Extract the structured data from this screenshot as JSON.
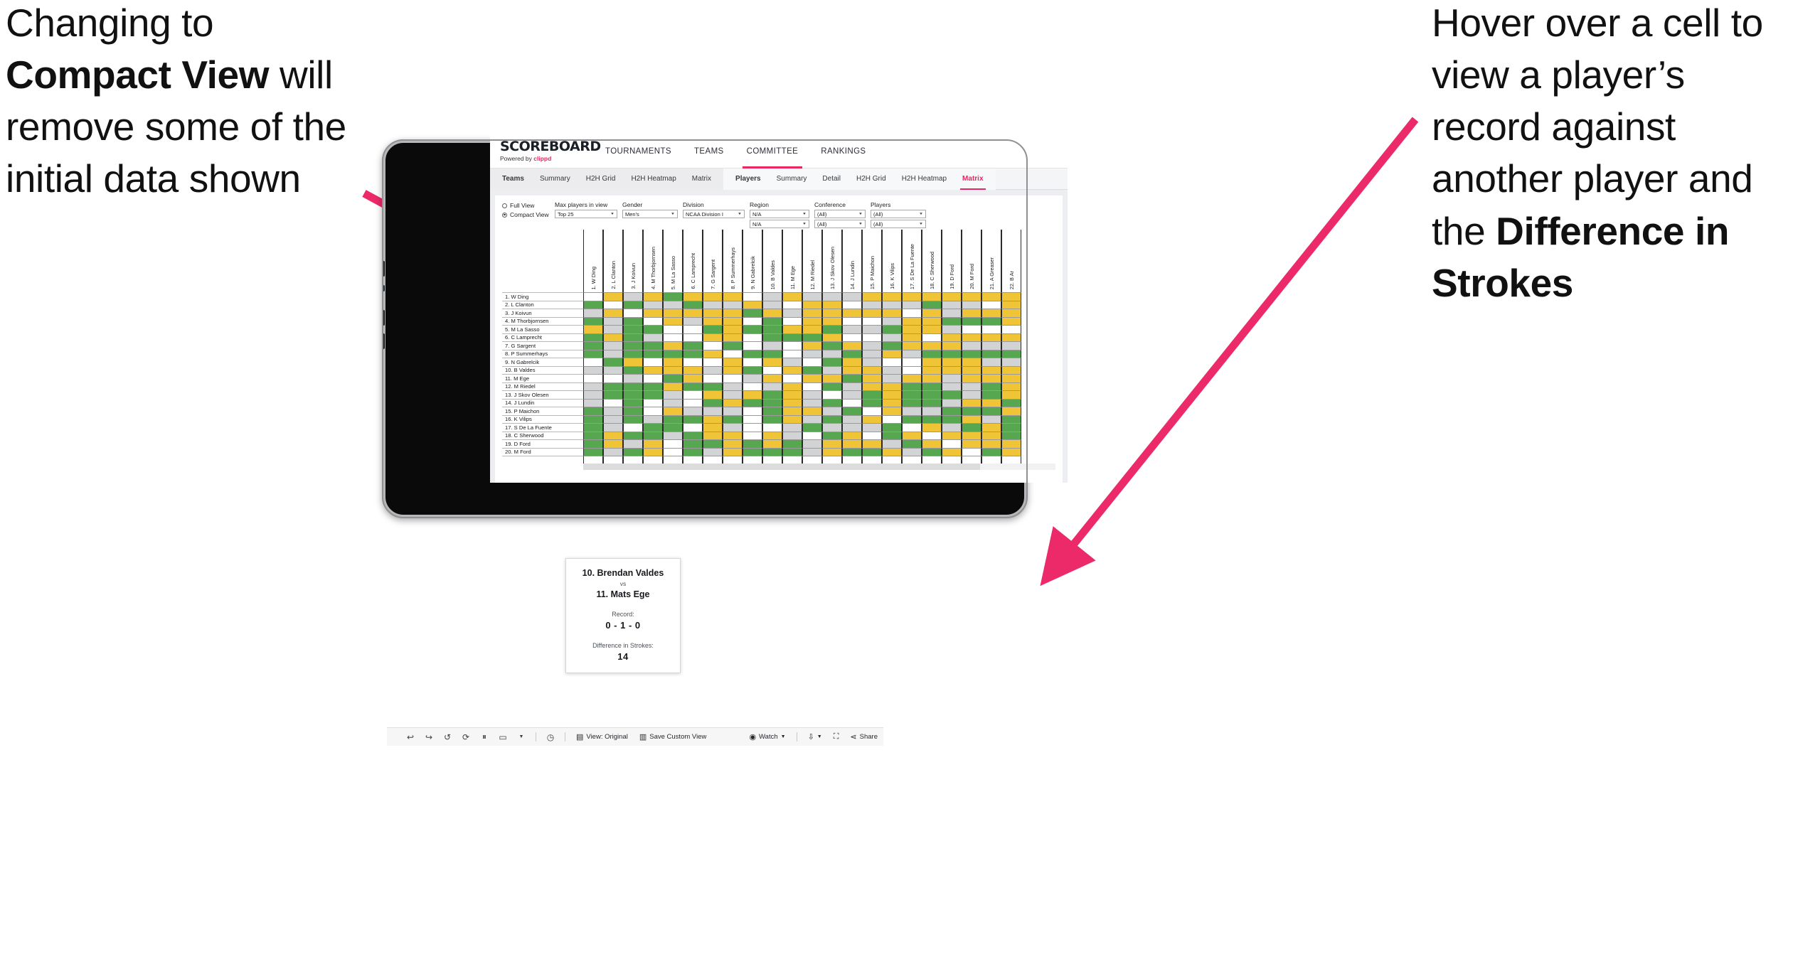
{
  "annotations": {
    "left": {
      "line1": "Changing to",
      "bold1": "Compact View",
      "line2": " will remove some of the initial data shown"
    },
    "right": {
      "line1": "Hover over a cell to view a player’s record against another player and the ",
      "bold1": "Difference in Strokes"
    },
    "arrow_color": "#ec2a6a"
  },
  "app": {
    "logo": {
      "word": "SCOREBOARD",
      "powered_prefix": "Powered by ",
      "brand": "clippd"
    },
    "main_nav": [
      {
        "label": "TOURNAMENTS",
        "active": false
      },
      {
        "label": "TEAMS",
        "active": false
      },
      {
        "label": "COMMITTEE",
        "active": true
      },
      {
        "label": "RANKINGS",
        "active": false
      }
    ],
    "sub_nav_teams": [
      {
        "label": "Teams",
        "bold": true,
        "active": false
      },
      {
        "label": "Summary",
        "bold": false,
        "active": false
      },
      {
        "label": "H2H Grid",
        "bold": false,
        "active": false
      },
      {
        "label": "H2H Heatmap",
        "bold": false,
        "active": false
      },
      {
        "label": "Matrix",
        "bold": false,
        "active": false
      }
    ],
    "sub_nav_players": [
      {
        "label": "Players",
        "bold": true,
        "active": false
      },
      {
        "label": "Summary",
        "bold": false,
        "active": false
      },
      {
        "label": "Detail",
        "bold": false,
        "active": false
      },
      {
        "label": "H2H Grid",
        "bold": false,
        "active": false
      },
      {
        "label": "H2H Heatmap",
        "bold": false,
        "active": false
      },
      {
        "label": "Matrix",
        "bold": false,
        "active": true
      }
    ],
    "accent_color": "#e8285f"
  },
  "filters": {
    "view_mode": {
      "full_label": "Full View",
      "compact_label": "Compact View",
      "selected": "Compact View"
    },
    "max_players": {
      "label": "Max players in view",
      "value": "Top 25"
    },
    "gender": {
      "label": "Gender",
      "value": "Men's"
    },
    "division": {
      "label": "Division",
      "value": "NCAA Division I"
    },
    "region": {
      "label": "Region",
      "value1": "N/A",
      "value2": "N/A"
    },
    "conference": {
      "label": "Conference",
      "value1": "(All)",
      "value2": "(All)"
    },
    "players": {
      "label": "Players",
      "value1": "(All)",
      "value2": "(All)"
    }
  },
  "matrix": {
    "row_labels": [
      "1. W Ding",
      "2. L Clanton",
      "3. J Koivun",
      "4. M Thorbjornsen",
      "5. M La Sasso",
      "6. C Lamprecht",
      "7. G Sargent",
      "8. P Summerhays",
      "9. N Gabrelcik",
      "10. B Valdes",
      "11. M Ege",
      "12. M Riedel",
      "13. J Skov Olesen",
      "14. J Lundin",
      "15. P Maichon",
      "16. K Vilips",
      "17. S De La Fuente",
      "18. C Sherwood",
      "19. D Ford",
      "20. M Ford"
    ],
    "column_labels": [
      "1. W Ding",
      "2. L Clanton",
      "3. J Koivun",
      "4. M Thorbjornsen",
      "5. M La Sasso",
      "6. C Lamprecht",
      "7. G Sargent",
      "8. P Summerhays",
      "9. N Gabrelcik",
      "10. B Valdes",
      "11. M Ege",
      "12. M Riedel",
      "13. J Skov Olesen",
      "14. J Lundin",
      "15. P Maichon",
      "16. K Vilips",
      "17. S De La Fuente",
      "18. C Sherwood",
      "19. D Ford",
      "20. M Ford",
      "21. A Greaser",
      "22. B Ar"
    ],
    "legend": {
      "win": "#57a750",
      "loss": "#efc437",
      "tie": "#d2d3d5",
      "none": "#ffffff"
    },
    "cells": [
      [
        "w",
        "y",
        "a",
        "y",
        "g",
        "y",
        "y",
        "y",
        "w",
        "a",
        "y",
        "a",
        "a",
        "a",
        "y",
        "y",
        "y",
        "y",
        "y",
        "y",
        "y",
        "y"
      ],
      [
        "g",
        "w",
        "g",
        "a",
        "a",
        "g",
        "a",
        "a",
        "y",
        "a",
        "w",
        "y",
        "y",
        "w",
        "a",
        "a",
        "a",
        "g",
        "a",
        "a",
        "w",
        "y"
      ],
      [
        "a",
        "y",
        "w",
        "y",
        "y",
        "y",
        "y",
        "y",
        "g",
        "y",
        "a",
        "y",
        "y",
        "y",
        "y",
        "y",
        "w",
        "y",
        "a",
        "y",
        "y",
        "y"
      ],
      [
        "g",
        "a",
        "g",
        "w",
        "y",
        "a",
        "y",
        "y",
        "w",
        "g",
        "w",
        "y",
        "y",
        "w",
        "w",
        "a",
        "y",
        "y",
        "g",
        "g",
        "g",
        "y"
      ],
      [
        "y",
        "a",
        "g",
        "g",
        "w",
        "w",
        "g",
        "y",
        "g",
        "g",
        "y",
        "y",
        "g",
        "a",
        "a",
        "g",
        "y",
        "y",
        "a",
        "w",
        "w",
        "w"
      ],
      [
        "g",
        "y",
        "g",
        "a",
        "w",
        "w",
        "y",
        "y",
        "w",
        "g",
        "g",
        "g",
        "y",
        "w",
        "w",
        "a",
        "y",
        "w",
        "y",
        "y",
        "y",
        "y"
      ],
      [
        "g",
        "a",
        "g",
        "g",
        "y",
        "g",
        "w",
        "g",
        "w",
        "a",
        "w",
        "y",
        "g",
        "y",
        "a",
        "g",
        "y",
        "y",
        "y",
        "a",
        "a",
        "a"
      ],
      [
        "g",
        "a",
        "g",
        "g",
        "g",
        "g",
        "y",
        "w",
        "g",
        "g",
        "w",
        "a",
        "a",
        "g",
        "a",
        "y",
        "a",
        "g",
        "g",
        "g",
        "g",
        "g"
      ],
      [
        "w",
        "g",
        "y",
        "w",
        "y",
        "w",
        "w",
        "y",
        "w",
        "y",
        "a",
        "w",
        "g",
        "y",
        "a",
        "w",
        "w",
        "y",
        "y",
        "y",
        "a",
        "a"
      ],
      [
        "a",
        "a",
        "g",
        "y",
        "y",
        "y",
        "a",
        "y",
        "g",
        "w",
        "y",
        "g",
        "a",
        "y",
        "y",
        "a",
        "w",
        "y",
        "y",
        "y",
        "y",
        "y"
      ],
      [
        "w",
        "w",
        "a",
        "w",
        "g",
        "y",
        "w",
        "w",
        "a",
        "y",
        "w",
        "y",
        "y",
        "g",
        "y",
        "a",
        "y",
        "y",
        "a",
        "y",
        "y",
        "y"
      ],
      [
        "a",
        "g",
        "g",
        "g",
        "y",
        "g",
        "g",
        "a",
        "w",
        "a",
        "y",
        "w",
        "g",
        "a",
        "y",
        "y",
        "g",
        "g",
        "a",
        "a",
        "g",
        "y"
      ],
      [
        "a",
        "g",
        "g",
        "g",
        "a",
        "w",
        "y",
        "a",
        "y",
        "g",
        "y",
        "a",
        "w",
        "a",
        "g",
        "y",
        "g",
        "g",
        "g",
        "a",
        "g",
        "y"
      ],
      [
        "a",
        "w",
        "g",
        "w",
        "a",
        "w",
        "g",
        "y",
        "g",
        "g",
        "y",
        "a",
        "g",
        "w",
        "g",
        "y",
        "g",
        "g",
        "a",
        "y",
        "y",
        "g"
      ],
      [
        "g",
        "a",
        "g",
        "w",
        "y",
        "a",
        "a",
        "a",
        "w",
        "g",
        "y",
        "y",
        "a",
        "g",
        "w",
        "y",
        "a",
        "a",
        "g",
        "g",
        "g",
        "y"
      ],
      [
        "g",
        "a",
        "g",
        "a",
        "g",
        "g",
        "y",
        "g",
        "w",
        "g",
        "y",
        "a",
        "g",
        "a",
        "y",
        "w",
        "g",
        "g",
        "g",
        "y",
        "a",
        "g"
      ],
      [
        "g",
        "a",
        "w",
        "g",
        "g",
        "w",
        "y",
        "a",
        "w",
        "w",
        "a",
        "g",
        "a",
        "a",
        "a",
        "g",
        "w",
        "y",
        "a",
        "g",
        "y",
        "g"
      ],
      [
        "g",
        "y",
        "g",
        "g",
        "a",
        "g",
        "y",
        "y",
        "w",
        "y",
        "a",
        "w",
        "g",
        "y",
        "w",
        "g",
        "y",
        "w",
        "y",
        "y",
        "y",
        "g"
      ],
      [
        "g",
        "y",
        "a",
        "y",
        "w",
        "g",
        "g",
        "y",
        "g",
        "y",
        "g",
        "a",
        "y",
        "y",
        "y",
        "a",
        "g",
        "y",
        "w",
        "y",
        "y",
        "y"
      ],
      [
        "g",
        "a",
        "g",
        "y",
        "w",
        "g",
        "a",
        "y",
        "g",
        "g",
        "g",
        "a",
        "y",
        "g",
        "g",
        "y",
        "a",
        "g",
        "y",
        "w",
        "g",
        "y"
      ]
    ]
  },
  "tooltip": {
    "player_a": "10. Brendan Valdes",
    "vs": "vs",
    "player_b": "11. Mats Ege",
    "record_label": "Record:",
    "record_value": "0 - 1 - 0",
    "diff_label": "Difference in Strokes:",
    "diff_value": "14"
  },
  "toolbar": {
    "icons": [
      "undo-icon",
      "redo-icon",
      "revert-icon",
      "refresh-icon",
      "pause-icon",
      "pill-icon",
      "caret-icon",
      "help-icon"
    ],
    "view_label": "View: Original",
    "save_label": "Save Custom View",
    "watch_label": "Watch",
    "share_label": "Share"
  }
}
